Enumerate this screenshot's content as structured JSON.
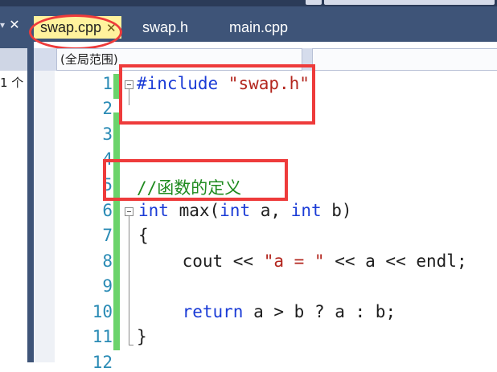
{
  "left_panel": {
    "count_text": "1 个",
    "close_glyph": "✕"
  },
  "tabs": [
    {
      "label": "swap.cpp",
      "active": true,
      "close_glyph": "✕"
    },
    {
      "label": "swap.h",
      "active": false
    },
    {
      "label": "main.cpp",
      "active": false
    }
  ],
  "scope": {
    "label": "(全局范围)"
  },
  "code_lines": [
    {
      "num": "1",
      "parts": [
        {
          "t": "#include ",
          "c": "kw"
        },
        {
          "t": "\"swap.h\"",
          "c": "str"
        }
      ]
    },
    {
      "num": "2",
      "parts": []
    },
    {
      "num": "3",
      "parts": []
    },
    {
      "num": "4",
      "parts": []
    },
    {
      "num": "5",
      "parts": [
        {
          "t": "//函数的定义",
          "c": "cmt"
        }
      ]
    },
    {
      "num": "6",
      "parts": [
        {
          "t": "int",
          "c": "kw"
        },
        {
          "t": " max(",
          "c": ""
        },
        {
          "t": "int",
          "c": "kw"
        },
        {
          "t": " a, ",
          "c": ""
        },
        {
          "t": "int",
          "c": "kw"
        },
        {
          "t": " b)",
          "c": ""
        }
      ]
    },
    {
      "num": "7",
      "parts": [
        {
          "t": "{",
          "c": ""
        }
      ]
    },
    {
      "num": "8",
      "parts": [
        {
          "t": "    cout << ",
          "c": ""
        },
        {
          "t": "\"a = \"",
          "c": "str"
        },
        {
          "t": " << a << endl;",
          "c": ""
        }
      ]
    },
    {
      "num": "9",
      "parts": []
    },
    {
      "num": "10",
      "parts": [
        {
          "t": "    ",
          "c": ""
        },
        {
          "t": "return",
          "c": "kw"
        },
        {
          "t": " a > b ? a : b;",
          "c": ""
        }
      ]
    },
    {
      "num": "11",
      "parts": [
        {
          "t": "}",
          "c": ""
        }
      ]
    },
    {
      "num": "12",
      "parts": []
    }
  ],
  "colors": {
    "tab_bar": "#3e5478",
    "active_tab": "#fff29d",
    "line_number": "#2a8bb5",
    "keyword": "#1a3bd6",
    "string": "#b3261e",
    "comment": "#1e8a1e",
    "change_bar": "#6bd36b",
    "annotation_red": "#ee3b3b"
  }
}
